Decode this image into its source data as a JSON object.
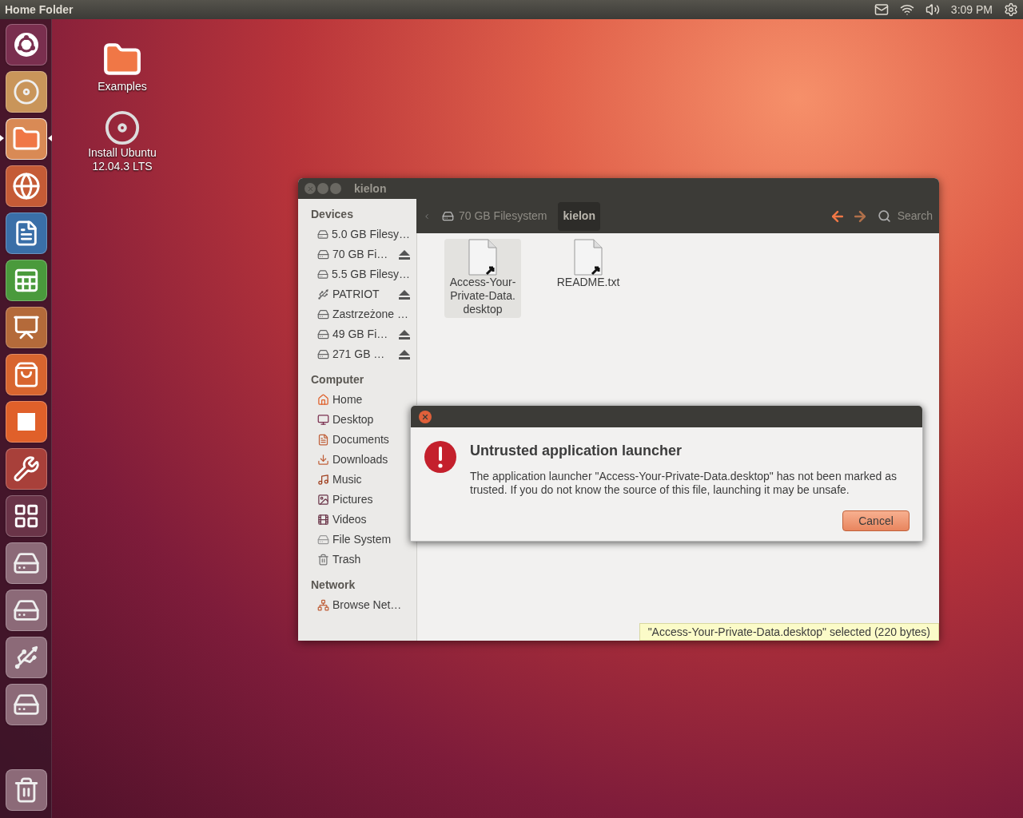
{
  "top_panel": {
    "title": "Home Folder",
    "clock": "3:09 PM"
  },
  "launcher": [
    {
      "kind": "dash",
      "running": false
    },
    {
      "kind": "installer",
      "running": false
    },
    {
      "kind": "files",
      "running": true
    },
    {
      "kind": "browser",
      "running": false
    },
    {
      "kind": "writer",
      "running": false
    },
    {
      "kind": "calc",
      "running": false
    },
    {
      "kind": "impress",
      "running": false
    },
    {
      "kind": "store",
      "running": false
    },
    {
      "kind": "cloud",
      "running": false
    },
    {
      "kind": "settings",
      "running": false
    },
    {
      "kind": "workspaces",
      "running": false
    },
    {
      "kind": "drive",
      "running": false
    },
    {
      "kind": "drive",
      "running": false
    },
    {
      "kind": "usb",
      "running": false
    },
    {
      "kind": "drive",
      "running": false
    }
  ],
  "launcher_trash": {
    "running": false
  },
  "desktop_icons": [
    {
      "kind": "folder",
      "label": "Examples"
    },
    {
      "kind": "installer",
      "label": "Install Ubuntu 12.04.3 LTS"
    }
  ],
  "file_window": {
    "title": "kielon",
    "breadcrumbs": [
      {
        "label": "70 GB Filesystem",
        "selected": false,
        "kind": "drive"
      },
      {
        "label": "kielon",
        "selected": true,
        "kind": "none"
      }
    ],
    "search_label": "Search",
    "sidebar": [
      {
        "heading": "Devices",
        "items": [
          {
            "label": "5.0 GB Filesy…",
            "kind": "drive",
            "eject": false
          },
          {
            "label": "70 GB Fi…",
            "kind": "drive",
            "eject": true
          },
          {
            "label": "5.5 GB Filesy…",
            "kind": "drive",
            "eject": false
          },
          {
            "label": "PATRIOT",
            "kind": "usb",
            "eject": true
          },
          {
            "label": "Zastrzeżone …",
            "kind": "drive",
            "eject": false
          },
          {
            "label": "49 GB Fi…",
            "kind": "drive",
            "eject": true
          },
          {
            "label": "271 GB …",
            "kind": "drive",
            "eject": true
          }
        ]
      },
      {
        "heading": "Computer",
        "items": [
          {
            "label": "Home",
            "kind": "home",
            "eject": false
          },
          {
            "label": "Desktop",
            "kind": "desktop",
            "eject": false
          },
          {
            "label": "Documents",
            "kind": "documents",
            "eject": false
          },
          {
            "label": "Downloads",
            "kind": "downloads",
            "eject": false
          },
          {
            "label": "Music",
            "kind": "music",
            "eject": false
          },
          {
            "label": "Pictures",
            "kind": "pictures",
            "eject": false
          },
          {
            "label": "Videos",
            "kind": "videos",
            "eject": false
          },
          {
            "label": "File System",
            "kind": "filesystem",
            "eject": false
          },
          {
            "label": "Trash",
            "kind": "trash",
            "eject": false
          }
        ]
      },
      {
        "heading": "Network",
        "items": [
          {
            "label": "Browse Net…",
            "kind": "network",
            "eject": false
          }
        ]
      }
    ],
    "files": [
      {
        "lines": [
          "Access-Your-",
          "Private-Data.",
          "desktop"
        ],
        "selected": true
      },
      {
        "lines": [
          "README.txt"
        ],
        "selected": false
      }
    ],
    "status": "\"Access-Your-Private-Data.desktop\" selected (220 bytes)"
  },
  "dialog": {
    "title": "Untrusted application launcher",
    "message": "The application launcher \"Access-Your-Private-Data.desktop\" has not been marked as trusted. If you do not know the source of this file, launching it may be unsafe.",
    "buttons": [
      "Cancel"
    ]
  }
}
